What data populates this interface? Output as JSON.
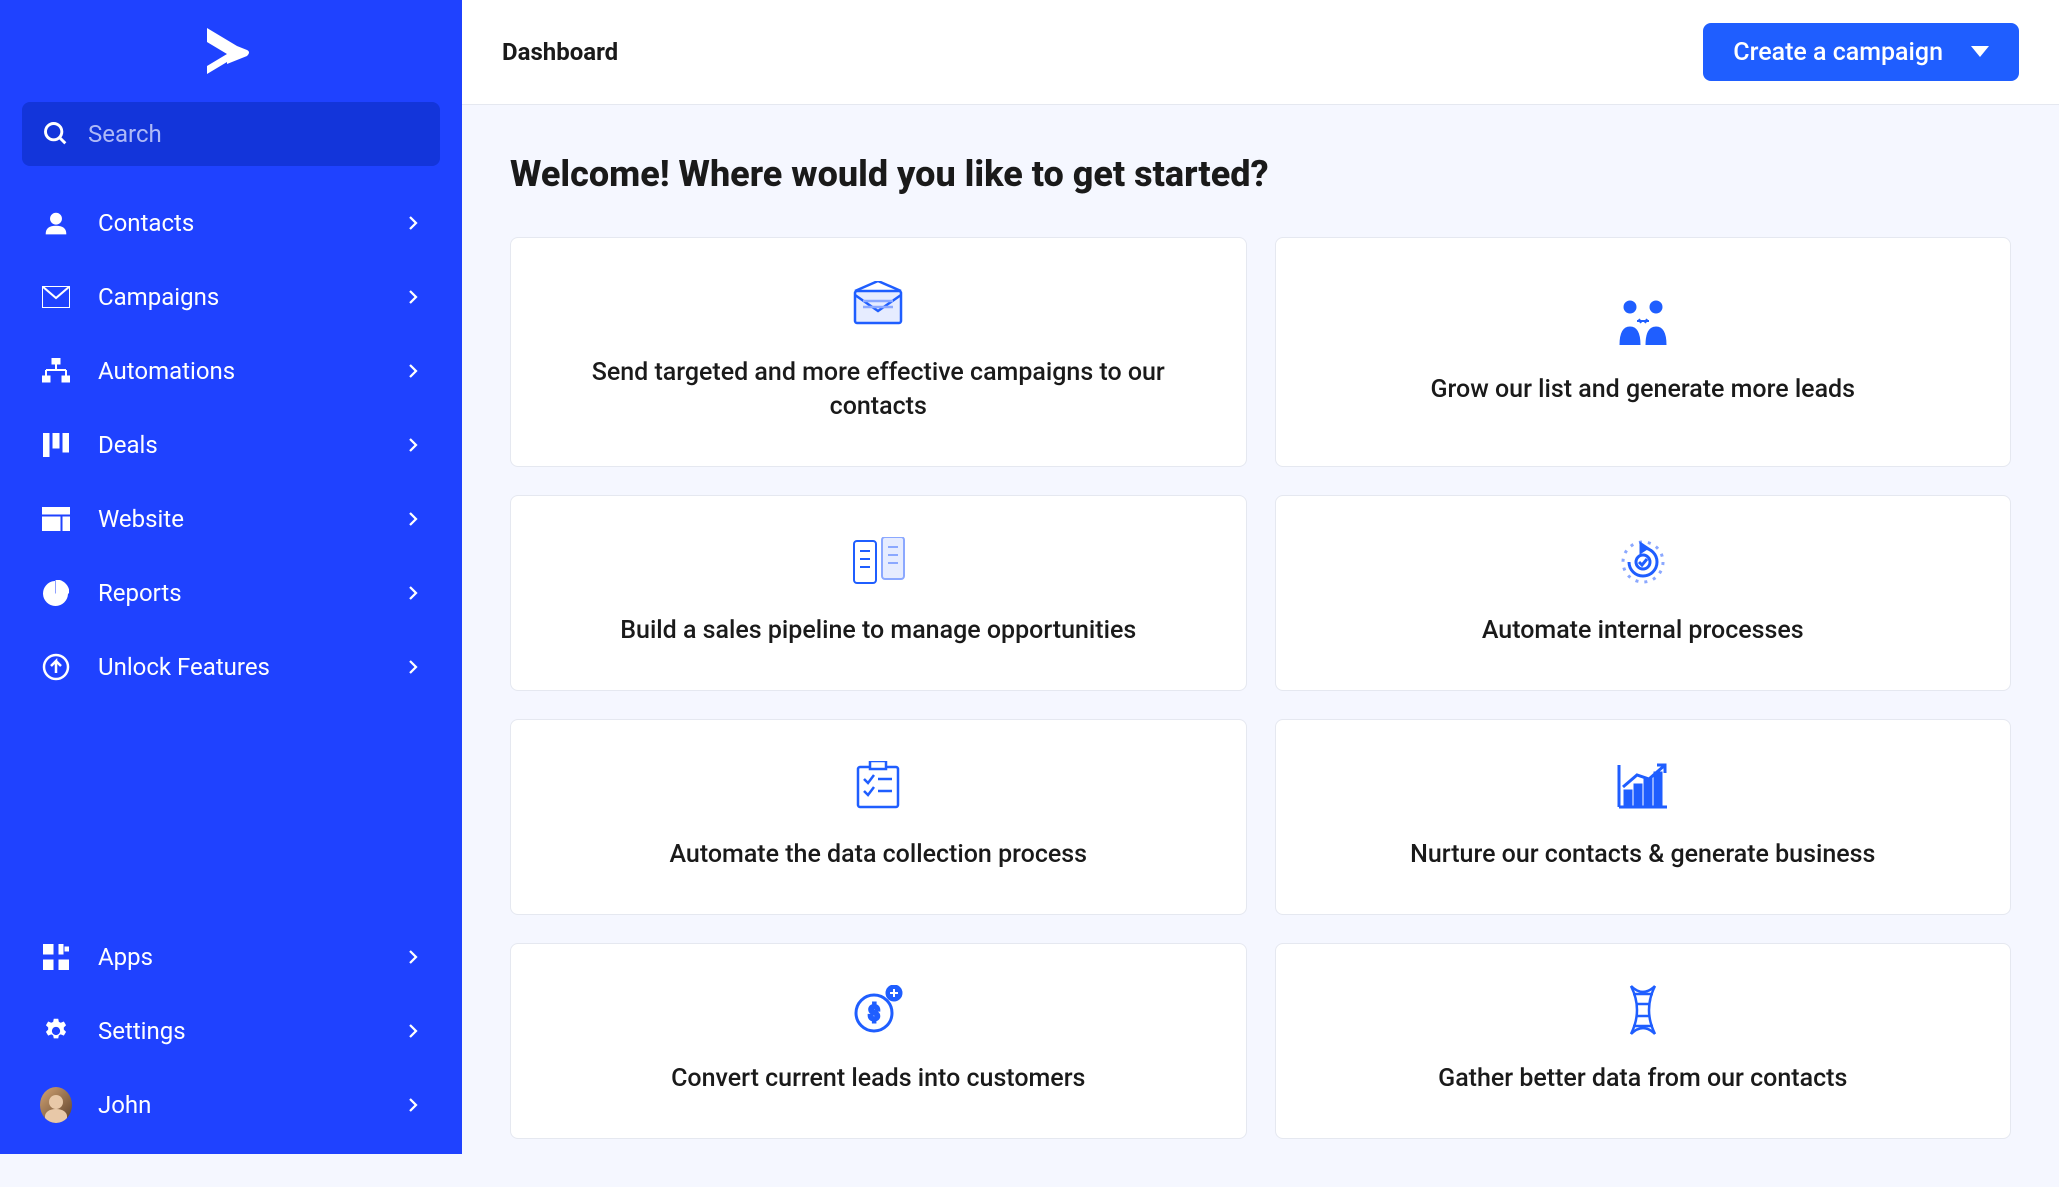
{
  "sidebar": {
    "search_placeholder": "Search",
    "items": [
      {
        "icon": "person-icon",
        "label": "Contacts"
      },
      {
        "icon": "envelope-icon",
        "label": "Campaigns"
      },
      {
        "icon": "automation-icon",
        "label": "Automations"
      },
      {
        "icon": "columns-icon",
        "label": "Deals"
      },
      {
        "icon": "browser-icon",
        "label": "Website"
      },
      {
        "icon": "pie-icon",
        "label": "Reports"
      },
      {
        "icon": "unlock-icon",
        "label": "Unlock Features"
      }
    ],
    "bottom_items": [
      {
        "icon": "apps-icon",
        "label": "Apps"
      },
      {
        "icon": "gear-icon",
        "label": "Settings"
      }
    ],
    "user_label": "John"
  },
  "topbar": {
    "title": "Dashboard",
    "cta_label": "Create a campaign"
  },
  "main": {
    "heading": "Welcome! Where would you like to get started?",
    "cards": [
      {
        "icon": "mail-icon",
        "text": "Send targeted and more effective campaigns to our contacts"
      },
      {
        "icon": "people-icon",
        "text": "Grow our list and generate more leads"
      },
      {
        "icon": "pipeline-icon",
        "text": "Build a sales pipeline to manage opportunities"
      },
      {
        "icon": "cycle-icon",
        "text": "Automate internal processes"
      },
      {
        "icon": "checklist-icon",
        "text": "Automate the data collection process"
      },
      {
        "icon": "chart-icon",
        "text": "Nurture our contacts & generate business"
      },
      {
        "icon": "dollar-icon",
        "text": "Convert current leads into customers"
      },
      {
        "icon": "dna-icon",
        "text": "Gather better data from our contacts"
      }
    ]
  }
}
